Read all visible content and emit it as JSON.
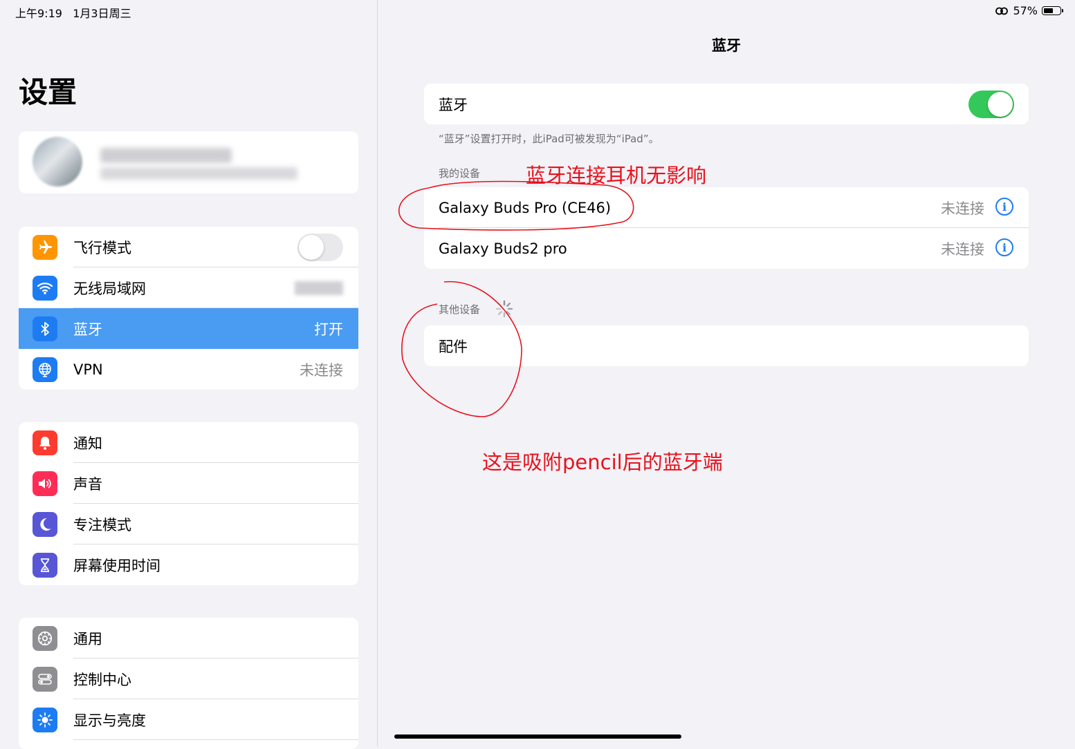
{
  "status": {
    "time": "上午9:19",
    "date": "1月3日周三",
    "battery_pct": "57%",
    "battery_level": 0.57
  },
  "sidebar": {
    "title": "设置",
    "group1": [
      {
        "label": "飞行模式",
        "icon": "airplane-icon",
        "color": "#ff9500",
        "toggle": false
      },
      {
        "label": "无线局域网",
        "icon": "wifi-icon",
        "color": "#1e7cf2"
      },
      {
        "label": "蓝牙",
        "icon": "bluetooth-icon",
        "color": "#1e7cf2",
        "value": "打开",
        "selected": true
      },
      {
        "label": "VPN",
        "icon": "globe-icon",
        "color": "#1e7cf2",
        "value": "未连接"
      }
    ],
    "group2": [
      {
        "label": "通知",
        "icon": "bell-icon",
        "color": "#ff3b30"
      },
      {
        "label": "声音",
        "icon": "speaker-icon",
        "color": "#ff2d55"
      },
      {
        "label": "专注模式",
        "icon": "moon-icon",
        "color": "#5856d6"
      },
      {
        "label": "屏幕使用时间",
        "icon": "hourglass-icon",
        "color": "#5856d6"
      }
    ],
    "group3": [
      {
        "label": "通用",
        "icon": "gear-icon",
        "color": "#8e8e93"
      },
      {
        "label": "控制中心",
        "icon": "switches-icon",
        "color": "#8e8e93"
      },
      {
        "label": "显示与亮度",
        "icon": "sun-icon",
        "color": "#1e7cf2"
      }
    ]
  },
  "detail": {
    "title": "蓝牙",
    "bt_label": "蓝牙",
    "bt_on": true,
    "footnote": "“蓝牙”设置打开时，此iPad可被发现为“iPad”。",
    "my_devices_header": "我的设备",
    "my_devices": [
      {
        "name": "Galaxy Buds Pro (CE46)",
        "status": "未连接"
      },
      {
        "name": "Galaxy Buds2 pro",
        "status": "未连接"
      }
    ],
    "other_devices_header": "其他设备",
    "other_devices": [
      {
        "name": "配件"
      }
    ]
  },
  "annotations": {
    "note1": "蓝牙连接耳机无影响",
    "note2": "这是吸附pencil后的蓝牙端",
    "color": "#e8111b"
  }
}
